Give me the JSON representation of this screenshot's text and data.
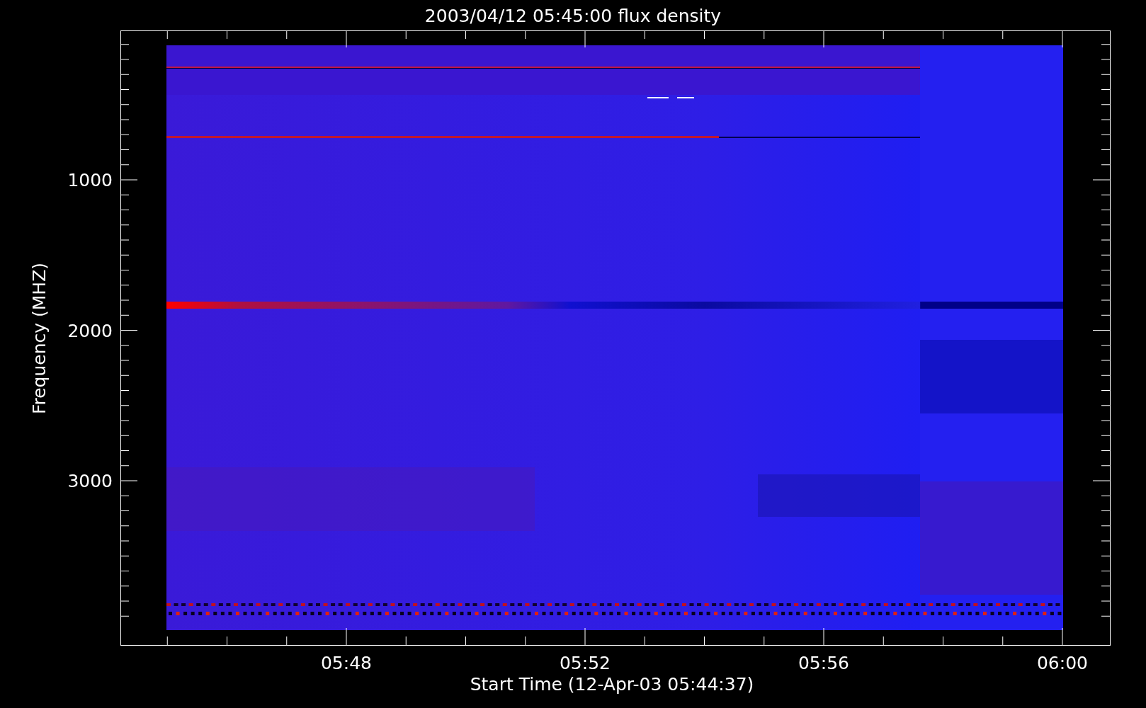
{
  "title": "2003/04/12 05:45:00 flux density",
  "y_axis": {
    "label": "Frequency (MHZ)",
    "ticks": [
      "1000",
      "2000",
      "3000"
    ]
  },
  "x_axis": {
    "label": "Start Time (12-Apr-03 05:44:37)",
    "ticks": [
      "05:48",
      "05:52",
      "05:56",
      "06:00"
    ]
  }
}
